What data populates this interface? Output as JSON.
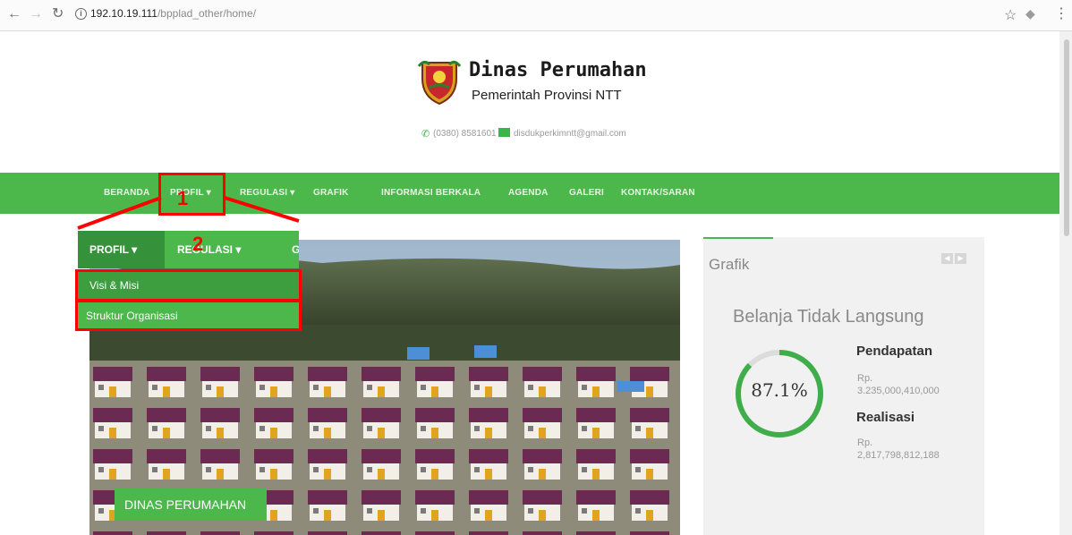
{
  "browser": {
    "back_icon": "arrow-left",
    "forward_icon": "arrow-right",
    "reload_icon": "reload",
    "url_host": "192.10.19.111",
    "url_path": "/bpplad_other/home/"
  },
  "header": {
    "title": "Dinas Perumahan",
    "subtitle": "Pemerintah Provinsi NTT",
    "phone": "(0380) 8581601",
    "email": "disdukperkimntt@gmail.com"
  },
  "nav": {
    "items": [
      "BERANDA",
      "PROFIL",
      "REGULASI",
      "GRAFIK",
      "INFORMASI BERKALA",
      "AGENDA",
      "GALERI",
      "KONTAK/SARAN"
    ],
    "dropdown_caret": "▾"
  },
  "annotations": {
    "step1": "1",
    "step2": "2"
  },
  "zoom": {
    "tab_profil": "PROFIL",
    "tab_regulasi": "REGULASI",
    "tab_partial": "G",
    "dropdown": [
      "Visi & Misi",
      "Struktur Organisasi"
    ]
  },
  "hero": {
    "badge": "DINAS PERUMAHAN"
  },
  "widget": {
    "title": "Grafik",
    "chart_title": "Belanja Tidak Langsung",
    "percent": "87.1%",
    "percent_value": 87.1,
    "pendapatan_label": "Pendapatan",
    "pendapatan_currency": "Rp.",
    "pendapatan_value": "3.235,000,410,000",
    "realisasi_label": "Realisasi",
    "realisasi_currency": "Rp.",
    "realisasi_value": "2,817,798,812,188"
  },
  "colors": {
    "nav_green": "#4cb84b",
    "annotation_red": "#ff0000"
  }
}
